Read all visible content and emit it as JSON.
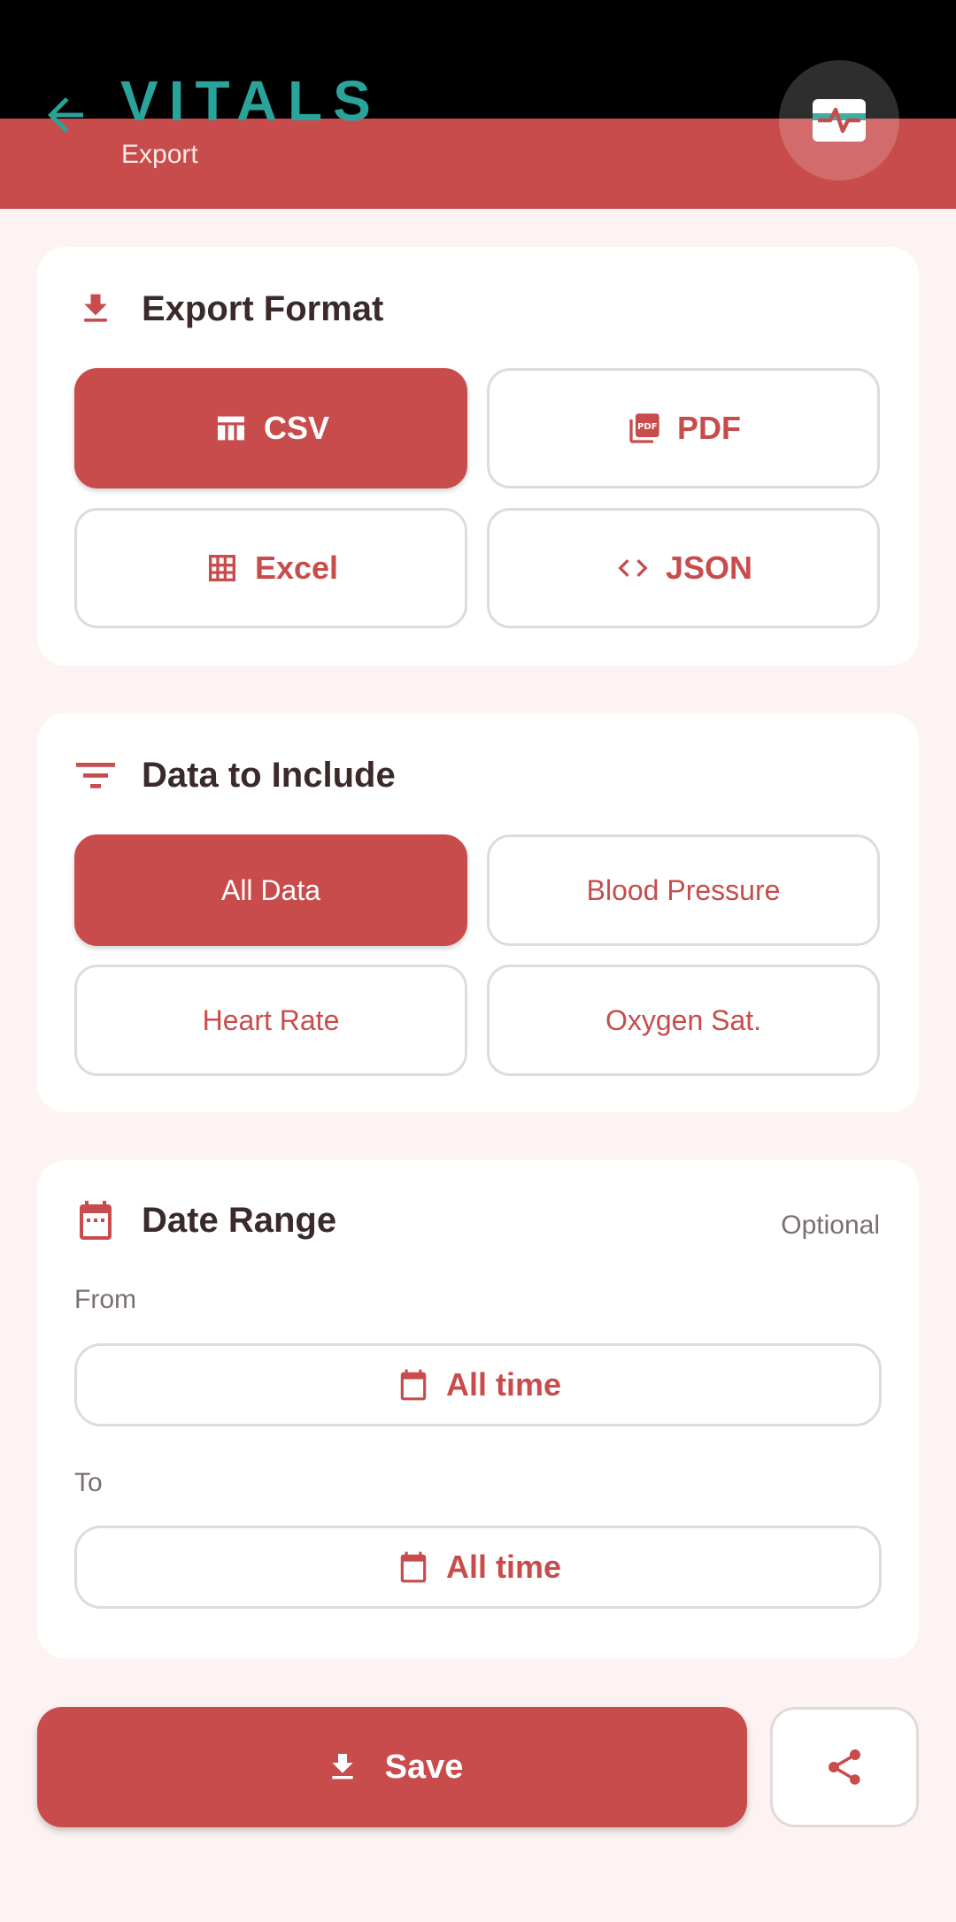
{
  "header": {
    "title": "VITALS",
    "subtitle": "Export",
    "back_icon": "arrow-left-icon",
    "logo_icon": "heartbeat-monitor-icon"
  },
  "colors": {
    "primary": "#c84c4c",
    "accent": "#2aa39b",
    "background": "#fdf3f2",
    "card": "#ffffff",
    "border": "#e2dada"
  },
  "export_format": {
    "title": "Export Format",
    "icon": "download-icon",
    "selected": "CSV",
    "options": [
      {
        "label": "CSV",
        "icon": "table-icon",
        "selected": true
      },
      {
        "label": "PDF",
        "icon": "pdf-icon",
        "selected": false
      },
      {
        "label": "Excel",
        "icon": "grid-icon",
        "selected": false
      },
      {
        "label": "JSON",
        "icon": "code-icon",
        "selected": false
      }
    ]
  },
  "data_include": {
    "title": "Data to Include",
    "icon": "filter-icon",
    "options": [
      {
        "label": "All Data",
        "selected": true
      },
      {
        "label": "Blood Pressure",
        "selected": false
      },
      {
        "label": "Heart Rate",
        "selected": false
      },
      {
        "label": "Oxygen Sat.",
        "selected": false
      }
    ]
  },
  "date_range": {
    "title": "Date Range",
    "icon": "calendar-icon",
    "optional_label": "Optional",
    "from_label": "From",
    "from_value": "All time",
    "to_label": "To",
    "to_value": "All time"
  },
  "actions": {
    "save_label": "Save",
    "save_icon": "download-icon",
    "share_icon": "share-icon"
  }
}
